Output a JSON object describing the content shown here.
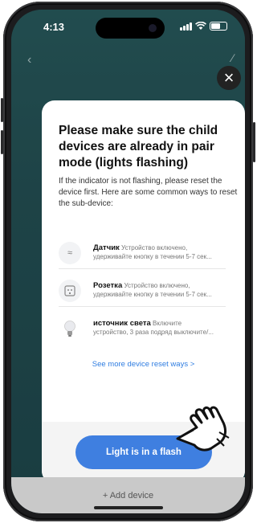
{
  "status_bar": {
    "time": "4:13"
  },
  "modal": {
    "title": "Please make sure the child devices are already in pair mode (lights flashing)",
    "description": "If the indicator is not flashing, please reset the device first. Here are some common ways to reset the sub-device:",
    "items": [
      {
        "name": "Датчик",
        "line1": " Устройство включено,",
        "line2": "удерживайте кнопку в течении 5-7 сек...",
        "icon": "sensor-icon"
      },
      {
        "name": "Розетка",
        "line1": " Устройство включено,",
        "line2": "удерживайте кнопку в течении 5-7 сек...",
        "icon": "socket-icon"
      },
      {
        "name": "источник света",
        "line1": " Включите",
        "line2": "устройство, 3 раза подряд выключите/...",
        "icon": "bulb-icon"
      }
    ],
    "more_link": "See more device reset ways >",
    "primary_button": "Light is in a flash"
  },
  "footer": {
    "add_device": "+ Add device"
  },
  "colors": {
    "accent": "#3f7fe0",
    "link": "#2f7de1",
    "background": "#2a5e63"
  }
}
